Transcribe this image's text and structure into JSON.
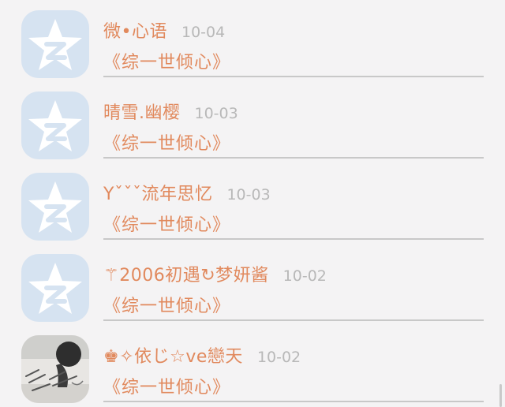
{
  "messages": [
    {
      "username": "微•心语",
      "date": "10-04",
      "text": "《综一世倾心》",
      "avatar": "qq-star-icon"
    },
    {
      "username": "晴雪.幽樱",
      "date": "10-03",
      "text": "《综一世倾心》",
      "avatar": "qq-star-icon"
    },
    {
      "username": "Yˇˇˇ流年思忆",
      "date": "10-03",
      "text": "《综一世倾心》",
      "avatar": "qq-star-icon"
    },
    {
      "username": "⚚2006初遇↻梦妍酱",
      "date": "10-02",
      "text": "《综一世倾心》",
      "avatar": "qq-star-icon"
    },
    {
      "username": "♚✧依じ☆ve戀天",
      "date": "10-02",
      "text": "《综一世倾心》",
      "avatar": "photo-avatar"
    }
  ],
  "colors": {
    "accent": "#e1895d",
    "date": "#b8b8b8",
    "avatar_bg": "#d6e3f1",
    "background": "#f4f3f4"
  }
}
